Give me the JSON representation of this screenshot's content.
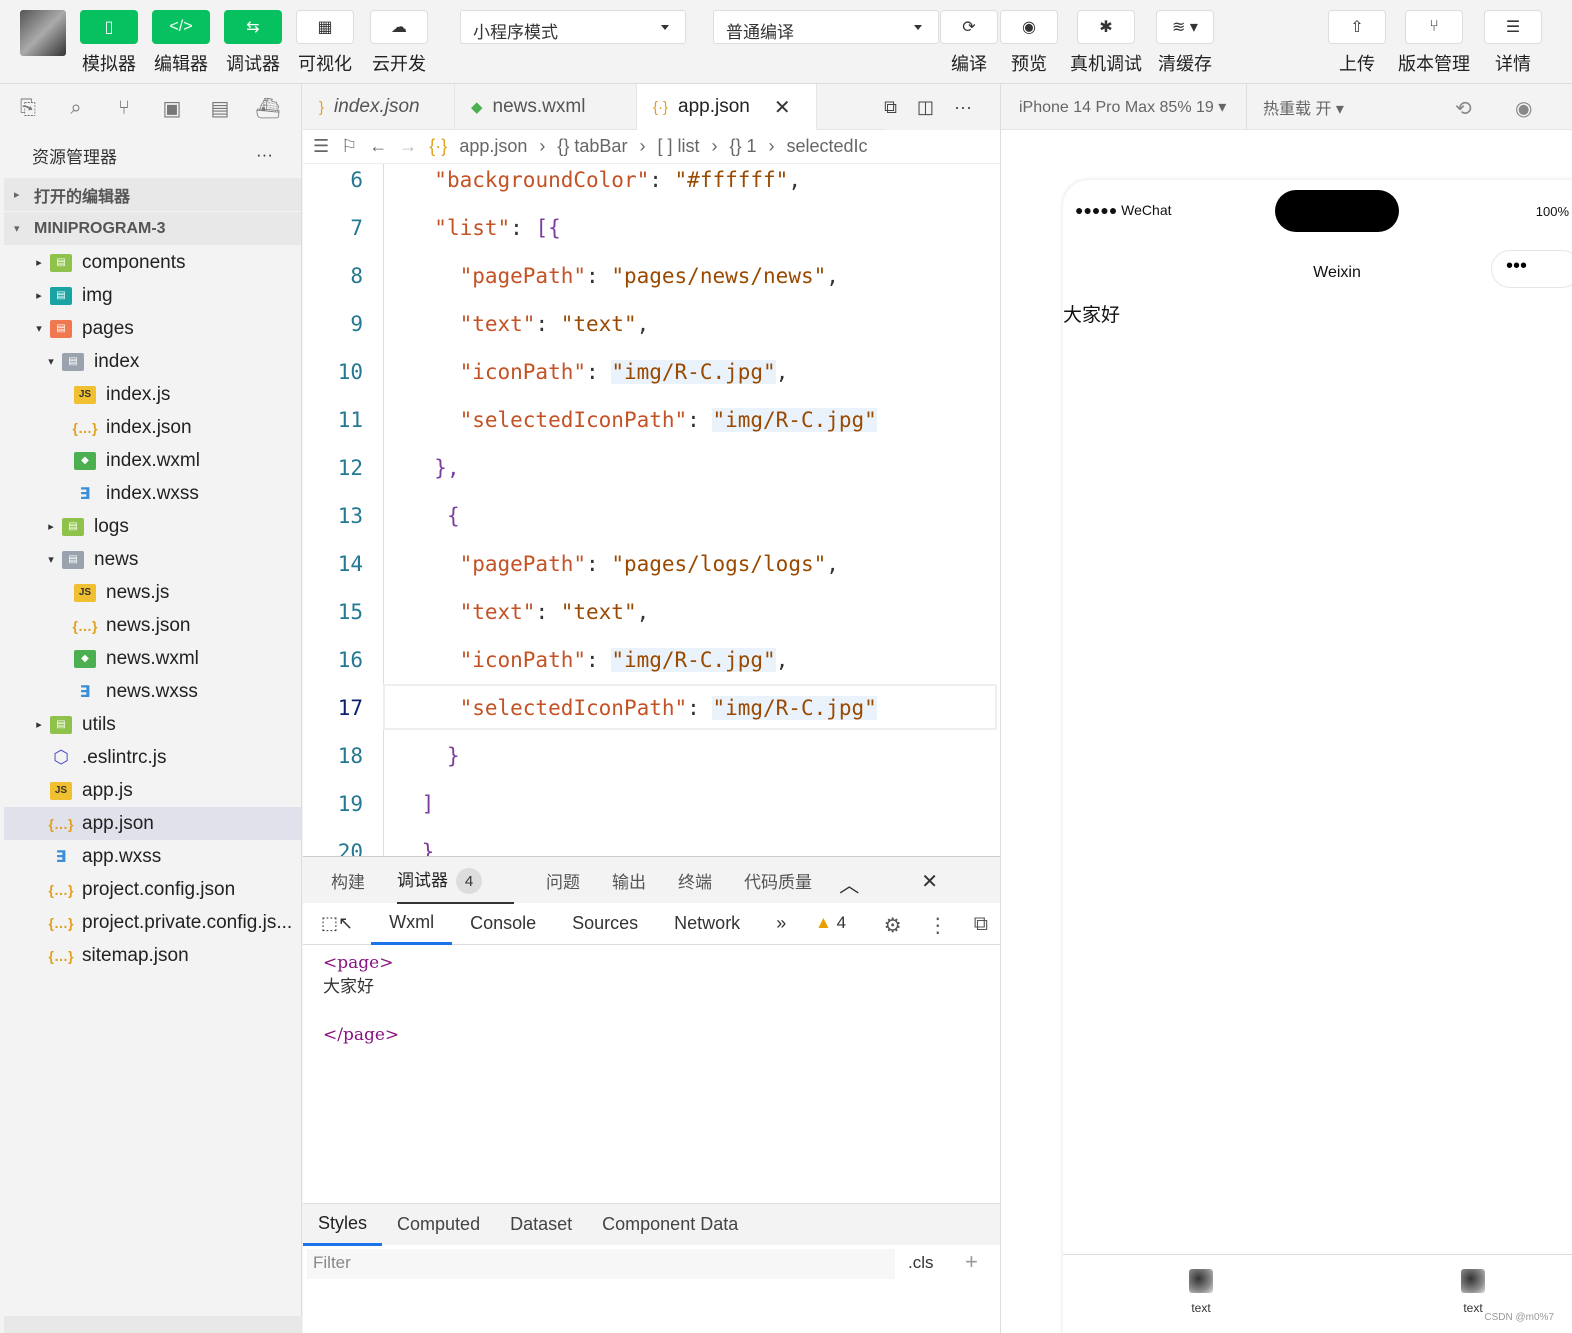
{
  "toolbar": {
    "buttons": [
      {
        "label": "模拟器",
        "icon": "phone-icon"
      },
      {
        "label": "编辑器",
        "icon": "code-icon"
      },
      {
        "label": "调试器",
        "icon": "debug-icon"
      },
      {
        "label": "可视化",
        "icon": "layout-icon"
      },
      {
        "label": "云开发",
        "icon": "cloud-icon"
      }
    ],
    "mode_select": "小程序模式",
    "compile_select": "普通编译",
    "right_buttons": [
      {
        "label": "编译",
        "icon": "refresh-icon"
      },
      {
        "label": "预览",
        "icon": "eye-icon"
      },
      {
        "label": "真机调试",
        "icon": "bug-icon"
      },
      {
        "label": "清缓存",
        "icon": "layers-icon"
      },
      {
        "label": "上传",
        "icon": "upload-icon"
      },
      {
        "label": "版本管理",
        "icon": "branch-icon"
      },
      {
        "label": "详情",
        "icon": "menu-icon"
      }
    ]
  },
  "explorer": {
    "title": "资源管理器",
    "more": "···",
    "open_editors": "打开的编辑器",
    "project": "MINIPROGRAM-3",
    "tree": [
      {
        "label": "components",
        "type": "fold",
        "depth": 1,
        "tw": "▸"
      },
      {
        "label": "img",
        "type": "foldb",
        "depth": 1,
        "tw": "▸"
      },
      {
        "label": "pages",
        "type": "foldo",
        "depth": 1,
        "tw": "▾"
      },
      {
        "label": "index",
        "type": "foldg",
        "depth": 2,
        "tw": "▾"
      },
      {
        "label": "index.js",
        "type": "js",
        "depth": 3,
        "tw": ""
      },
      {
        "label": "index.json",
        "type": "json",
        "depth": 3,
        "tw": ""
      },
      {
        "label": "index.wxml",
        "type": "wxml",
        "depth": 3,
        "tw": ""
      },
      {
        "label": "index.wxss",
        "type": "wxss",
        "depth": 3,
        "tw": ""
      },
      {
        "label": "logs",
        "type": "fold",
        "depth": 2,
        "tw": "▸"
      },
      {
        "label": "news",
        "type": "foldg",
        "depth": 2,
        "tw": "▾"
      },
      {
        "label": "news.js",
        "type": "js",
        "depth": 3,
        "tw": ""
      },
      {
        "label": "news.json",
        "type": "json",
        "depth": 3,
        "tw": ""
      },
      {
        "label": "news.wxml",
        "type": "wxml",
        "depth": 3,
        "tw": ""
      },
      {
        "label": "news.wxss",
        "type": "wxss",
        "depth": 3,
        "tw": ""
      },
      {
        "label": "utils",
        "type": "fold",
        "depth": 1,
        "tw": "▸"
      },
      {
        "label": ".eslintrc.js",
        "type": "esl",
        "depth": 1,
        "tw": ""
      },
      {
        "label": "app.js",
        "type": "js",
        "depth": 1,
        "tw": ""
      },
      {
        "label": "app.json",
        "type": "json",
        "depth": 1,
        "tw": "",
        "active": true
      },
      {
        "label": "app.wxss",
        "type": "wxss",
        "depth": 1,
        "tw": ""
      },
      {
        "label": "project.config.json",
        "type": "json",
        "depth": 1,
        "tw": ""
      },
      {
        "label": "project.private.config.js...",
        "type": "json",
        "depth": 1,
        "tw": ""
      },
      {
        "label": "sitemap.json",
        "type": "json",
        "depth": 1,
        "tw": ""
      }
    ]
  },
  "editor": {
    "tabs": [
      {
        "label": "index.json",
        "icon": "{ }",
        "italic": true
      },
      {
        "label": "news.wxml",
        "icon": "◆"
      },
      {
        "label": "app.json",
        "icon": "{·}",
        "active": true,
        "close": "✕"
      }
    ],
    "breadcrumb": [
      "app.json",
      "{} tabBar",
      "[ ] list",
      "{} 1",
      "selectedIc"
    ],
    "lines": [
      {
        "n": "6",
        "code": [
          [
            "ind",
            "  "
          ],
          [
            "key",
            "\"backgroundColor\""
          ],
          [
            "p",
            ": "
          ],
          [
            "str",
            "\"#ffffff\""
          ],
          [
            "p",
            ","
          ]
        ]
      },
      {
        "n": "7",
        "code": [
          [
            "ind",
            "  "
          ],
          [
            "key",
            "\"list\""
          ],
          [
            "p",
            ": "
          ],
          [
            "br",
            "[{"
          ]
        ]
      },
      {
        "n": "8",
        "code": [
          [
            "ind",
            "    "
          ],
          [
            "key",
            "\"pagePath\""
          ],
          [
            "p",
            ": "
          ],
          [
            "str",
            "\"pages/news/news\""
          ],
          [
            "p",
            ","
          ]
        ]
      },
      {
        "n": "9",
        "code": [
          [
            "ind",
            "    "
          ],
          [
            "key",
            "\"text\""
          ],
          [
            "p",
            ": "
          ],
          [
            "str",
            "\"text\""
          ],
          [
            "p",
            ","
          ]
        ]
      },
      {
        "n": "10",
        "code": [
          [
            "ind",
            "    "
          ],
          [
            "key",
            "\"iconPath\""
          ],
          [
            "p",
            ": "
          ],
          [
            "strh",
            "\"img/R-C.jpg\""
          ],
          [
            "p",
            ","
          ]
        ]
      },
      {
        "n": "11",
        "code": [
          [
            "ind",
            "    "
          ],
          [
            "key",
            "\"selectedIconPath\""
          ],
          [
            "p",
            ": "
          ],
          [
            "strh",
            "\"img/R-C.jpg\""
          ]
        ]
      },
      {
        "n": "12",
        "code": [
          [
            "ind",
            "  "
          ],
          [
            "br",
            "},"
          ]
        ]
      },
      {
        "n": "13",
        "code": [
          [
            "ind",
            "   "
          ],
          [
            "br",
            "{"
          ]
        ]
      },
      {
        "n": "14",
        "code": [
          [
            "ind",
            "    "
          ],
          [
            "key",
            "\"pagePath\""
          ],
          [
            "p",
            ": "
          ],
          [
            "str",
            "\"pages/logs/logs\""
          ],
          [
            "p",
            ","
          ]
        ]
      },
      {
        "n": "15",
        "code": [
          [
            "ind",
            "    "
          ],
          [
            "key",
            "\"text\""
          ],
          [
            "p",
            ": "
          ],
          [
            "str",
            "\"text\""
          ],
          [
            "p",
            ","
          ]
        ]
      },
      {
        "n": "16",
        "code": [
          [
            "ind",
            "    "
          ],
          [
            "key",
            "\"iconPath\""
          ],
          [
            "p",
            ": "
          ],
          [
            "strh",
            "\"img/R-C.jpg\""
          ],
          [
            "p",
            ","
          ]
        ]
      },
      {
        "n": "17",
        "code": [
          [
            "ind",
            "    "
          ],
          [
            "key",
            "\"selectedIconPath\""
          ],
          [
            "p",
            ": "
          ],
          [
            "strh",
            "\"img/R-C.jpg\""
          ]
        ]
      },
      {
        "n": "18",
        "code": [
          [
            "ind",
            "   "
          ],
          [
            "br",
            "}"
          ]
        ]
      },
      {
        "n": "19",
        "code": [
          [
            "ind",
            " "
          ],
          [
            "br",
            "]"
          ]
        ]
      },
      {
        "n": "20",
        "code": [
          [
            "ind",
            " "
          ],
          [
            "br",
            "}"
          ]
        ]
      }
    ]
  },
  "devtools": {
    "tabs": [
      "构建",
      "调试器",
      "问题",
      "输出",
      "终端",
      "代码质量"
    ],
    "badge": "4",
    "panel_tabs": [
      "Wxml",
      "Console",
      "Sources",
      "Network"
    ],
    "more": "»",
    "warn_count": "4",
    "dom_open": "<page>",
    "dom_text": "大家好",
    "dom_close": "</page>",
    "style_tabs": [
      "Styles",
      "Computed",
      "Dataset",
      "Component Data"
    ],
    "filter_placeholder": "Filter",
    "cls": ".cls",
    "plus": "+"
  },
  "simulator": {
    "device": "iPhone 14 Pro Max 85% 19 ▾",
    "hot_reload": "热重载 开 ▾",
    "status_left": "●●●●● WeChat",
    "battery": "100%",
    "nav_title": "Weixin",
    "capsule": "•••",
    "page_text": "大家好",
    "tabbar": [
      {
        "text": "text"
      },
      {
        "text": "text"
      }
    ],
    "watermark": "CSDN @m0%7"
  }
}
